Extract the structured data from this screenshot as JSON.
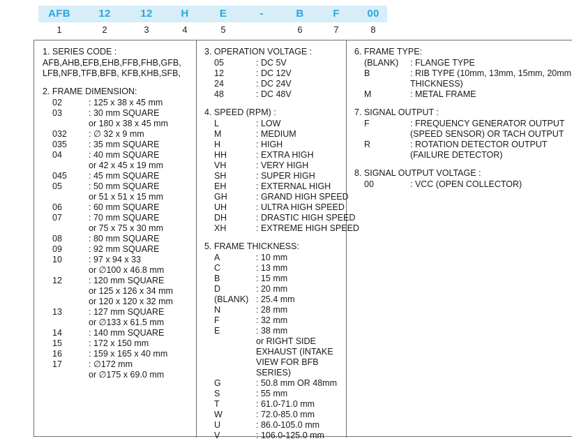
{
  "part_number": {
    "segments": [
      "AFB",
      "12",
      "12",
      "H",
      "E",
      "-",
      "B",
      "F",
      "00"
    ],
    "indices": [
      "1",
      "2",
      "3",
      "4",
      "5",
      "6",
      "7",
      "8"
    ],
    "band_color": "#d7eef9",
    "text_color": "#2ba7e0"
  },
  "sections": {
    "series_code": {
      "title": "1. SERIES CODE :",
      "lines": [
        "AFB,AHB,EFB,EHB,FFB,FHB,GFB,",
        "LFB,NFB,TFB,BFB, KFB,KHB,SFB,"
      ]
    },
    "frame_dimension": {
      "title": "2. FRAME DIMENSION:",
      "entries": [
        {
          "code": "02",
          "desc": ": 125 x 38 x 45 mm"
        },
        {
          "code": "03",
          "desc": ": 30 mm SQUARE",
          "cont": [
            "or 180 x 38 x 45 mm"
          ]
        },
        {
          "code": "032",
          "desc": ": ∅ 32 x 9 mm"
        },
        {
          "code": "035",
          "desc": ": 35 mm SQUARE"
        },
        {
          "code": "04",
          "desc": ": 40 mm SQUARE",
          "cont": [
            "or 42 x 45 x 19 mm"
          ]
        },
        {
          "code": "045",
          "desc": ": 45 mm SQUARE"
        },
        {
          "code": "05",
          "desc": ": 50 mm SQUARE",
          "cont": [
            "or 51 x 51 x 15 mm"
          ]
        },
        {
          "code": "06",
          "desc": ": 60 mm SQUARE"
        },
        {
          "code": "07",
          "desc": ": 70 mm SQUARE",
          "cont": [
            "or 75 x 75 x 30 mm"
          ]
        },
        {
          "code": "08",
          "desc": ": 80 mm SQUARE"
        },
        {
          "code": "09",
          "desc": ": 92 mm SQUARE"
        },
        {
          "code": "10",
          "desc": ": 97 x 94 x 33",
          "cont": [
            "or ∅100 x 46.8 mm"
          ]
        },
        {
          "code": "12",
          "desc": ": 120 mm SQUARE",
          "cont": [
            "or 125 x 126 x 34 mm",
            "or 120 x 120 x 32 mm"
          ]
        },
        {
          "code": "13",
          "desc": ": 127 mm SQUARE",
          "cont": [
            "or ∅133 x 61.5 mm"
          ]
        },
        {
          "code": "14",
          "desc": ": 140 mm SQUARE"
        },
        {
          "code": "15",
          "desc": ": 172 x 150 mm"
        },
        {
          "code": "16",
          "desc": ": 159 x 165 x 40 mm"
        },
        {
          "code": "17",
          "desc": ": ∅172 mm",
          "cont": [
            "or ∅175 x 69.0 mm"
          ]
        }
      ]
    },
    "operation_voltage": {
      "title": "3. OPERATION VOLTAGE :",
      "entries": [
        {
          "code": "05",
          "desc": ": DC 5V"
        },
        {
          "code": "12",
          "desc": ": DC 12V"
        },
        {
          "code": "24",
          "desc": ": DC 24V"
        },
        {
          "code": "48",
          "desc": ": DC 48V"
        }
      ]
    },
    "speed": {
      "title": "4. SPEED (RPM) :",
      "entries": [
        {
          "code": "L",
          "desc": ": LOW"
        },
        {
          "code": "M",
          "desc": ": MEDIUM"
        },
        {
          "code": "H",
          "desc": ": HIGH"
        },
        {
          "code": "HH",
          "desc": ": EXTRA HIGH"
        },
        {
          "code": "VH",
          "desc": ": VERY HIGH"
        },
        {
          "code": "SH",
          "desc": ": SUPER HIGH"
        },
        {
          "code": "EH",
          "desc": ": EXTERNAL HIGH"
        },
        {
          "code": "GH",
          "desc": ": GRAND HIGH SPEED"
        },
        {
          "code": "UH",
          "desc": ": ULTRA HIGH SPEED"
        },
        {
          "code": "DH",
          "desc": ": DRASTIC HIGH SPEED"
        },
        {
          "code": "XH",
          "desc": ": EXTREME HIGH SPEED"
        }
      ]
    },
    "frame_thickness": {
      "title": "5. FRAME THICKNESS:",
      "entries": [
        {
          "code": "A",
          "desc": ": 10 mm"
        },
        {
          "code": "C",
          "desc": ": 13 mm"
        },
        {
          "code": "B",
          "desc": ": 15 mm"
        },
        {
          "code": "D",
          "desc": ": 20 mm"
        },
        {
          "code": "(BLANK)",
          "desc": ": 25.4 mm"
        },
        {
          "code": "N",
          "desc": ": 28 mm"
        },
        {
          "code": "F",
          "desc": ": 32 mm"
        },
        {
          "code": "E",
          "desc": ": 38 mm",
          "cont": [
            "or RIGHT SIDE",
            "EXHAUST (INTAKE",
            "VIEW FOR BFB",
            "SERIES)"
          ]
        },
        {
          "code": "G",
          "desc": ": 50.8 mm OR 48mm"
        },
        {
          "code": "S",
          "desc": ": 55 mm"
        },
        {
          "code": "T",
          "desc": ": 61.0-71.0 mm"
        },
        {
          "code": "W",
          "desc": ": 72.0-85.0 mm"
        },
        {
          "code": "U",
          "desc": ": 86.0-105.0 mm"
        },
        {
          "code": "V",
          "desc": ": 106.0-125.0 mm"
        }
      ]
    },
    "frame_type": {
      "title": "6. FRAME TYPE:",
      "entries": [
        {
          "code": "(BLANK)",
          "desc": ": FLANGE TYPE"
        },
        {
          "code": "B",
          "desc": ": RIB TYPE (10mm, 13mm, 15mm, 20mm",
          "cont": [
            "THICKNESS)"
          ]
        },
        {
          "code": "M",
          "desc": ": METAL FRAME"
        }
      ]
    },
    "signal_output": {
      "title": "7. SIGNAL OUTPUT :",
      "entries": [
        {
          "code": "F",
          "desc": ": FREQUENCY GENERATOR OUTPUT",
          "cont": [
            "(SPEED SENSOR) OR TACH OUTPUT"
          ]
        },
        {
          "code": "R",
          "desc": ": ROTATION DETECTOR OUTPUT",
          "cont": [
            "(FAILURE DETECTOR)"
          ]
        }
      ]
    },
    "signal_output_voltage": {
      "title": "8. SIGNAL OUTPUT VOLTAGE :",
      "entries": [
        {
          "code": "00",
          "desc": ": VCC (OPEN COLLECTOR)"
        }
      ]
    }
  }
}
